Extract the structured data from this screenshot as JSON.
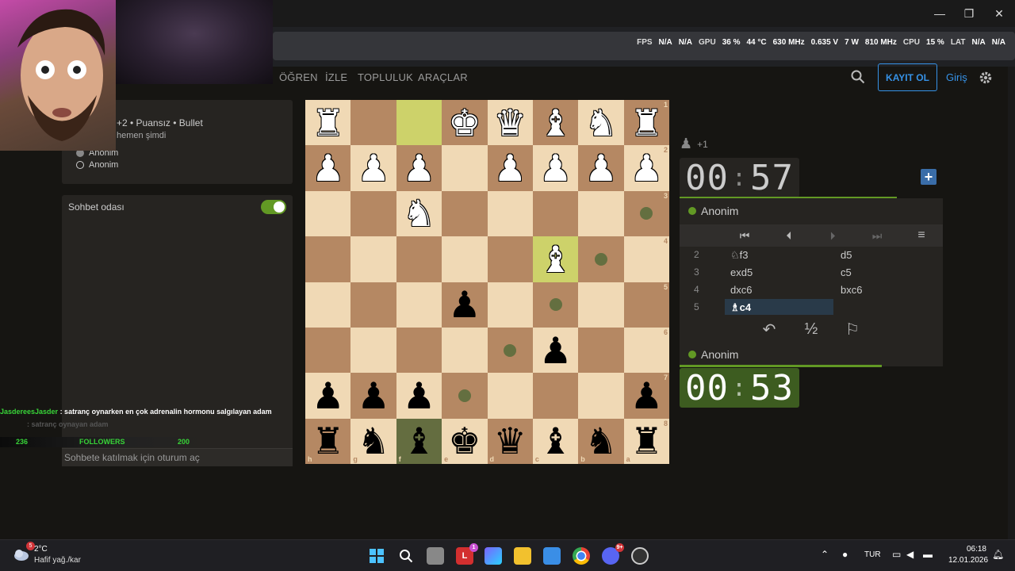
{
  "window": {
    "minimize": "—",
    "maximize": "❐",
    "close": "✕"
  },
  "hud": {
    "fps_label": "FPS",
    "fps_val": "N/A",
    "fps_val2": "N/A",
    "gpu_label": "GPU",
    "gpu_load": "36 %",
    "gpu_temp": "44 °C",
    "gpu_clock": "630 MHz",
    "gpu_volt": "0.635 V",
    "gpu_power": "7 W",
    "mem_clock": "810 MHz",
    "cpu_label": "CPU",
    "cpu_load": "15 %",
    "lat_label": "LAT",
    "lat_val": "N/A",
    "lat_val2": "N/A"
  },
  "nav": {
    "items": [
      "ÖĞREN",
      "İZLE",
      "TOPLULUK",
      "ARAÇLAR"
    ],
    "register": "KAYIT OL",
    "login": "Giriş"
  },
  "game": {
    "meta": "+2 • Puansız • Bullet",
    "started": "hemen şimdi",
    "players": [
      "Anonim",
      "Anonim"
    ]
  },
  "chat": {
    "title": "Sohbet odası",
    "placeholder": "Sohbete katılmak için oturum aç"
  },
  "board": {
    "ranks": [
      "1",
      "2",
      "3",
      "4",
      "5",
      "6",
      "7",
      "8"
    ],
    "files": [
      "h",
      "g",
      "f",
      "e",
      "d",
      "c",
      "b",
      "a"
    ],
    "rows": [
      [
        "wR",
        "",
        "HL",
        "wK",
        "wQ",
        "wB",
        "wN",
        "wR"
      ],
      [
        "wP",
        "wP",
        "wP",
        "",
        "wP",
        "wP",
        "wP",
        "wP"
      ],
      [
        "",
        "",
        "wN",
        "",
        "",
        "",
        "",
        "D"
      ],
      [
        "",
        "",
        "",
        "",
        "",
        "wBhl",
        "D",
        ""
      ],
      [
        "",
        "",
        "",
        "bP",
        "",
        "D",
        "",
        ""
      ],
      [
        "",
        "",
        "",
        "",
        "D",
        "bP",
        "",
        ""
      ],
      [
        "bP",
        "bP",
        "bP",
        "D",
        "",
        "",
        "",
        "bP"
      ],
      [
        "bR",
        "bN",
        "bBsel",
        "bK",
        "bQ",
        "bB",
        "bN",
        "bR"
      ]
    ]
  },
  "right": {
    "material": "+1",
    "topClock": "00:57",
    "topPlayer": "Anonim",
    "bottomPlayer": "Anonim",
    "bottomClock": "00:53",
    "moves": [
      {
        "n": "2",
        "w": "♘f3",
        "b": "d5"
      },
      {
        "n": "3",
        "w": "exd5",
        "b": "c5"
      },
      {
        "n": "4",
        "w": "dxc6",
        "b": "bxc6"
      },
      {
        "n": "5",
        "w": "♗c4",
        "b": ""
      }
    ],
    "actions": {
      "takeback": "↶",
      "draw": "½",
      "resign": "⚐"
    }
  },
  "overlay": {
    "chatUser": "JasdereesJasder",
    "chatMsg": " : satranç oynarken en çok adrenalin hormonu salgılayan adam",
    "chatSub": ": satranç oynayan adam",
    "followLeft": "236",
    "followLabel": "FOLLOWERS",
    "followRight": "200"
  },
  "taskbar": {
    "weatherTemp": "2°C",
    "weatherDesc": "Hafif yağ./kar",
    "weatherBadge": "5",
    "lang": "TUR",
    "time": "06:18",
    "date": "12.01.2026",
    "badge1": "1",
    "badge2": "9+"
  },
  "colors": {
    "accent": "#3692e7",
    "green": "#629924",
    "boardLight": "#f0d9b5",
    "boardDark": "#b58863"
  }
}
